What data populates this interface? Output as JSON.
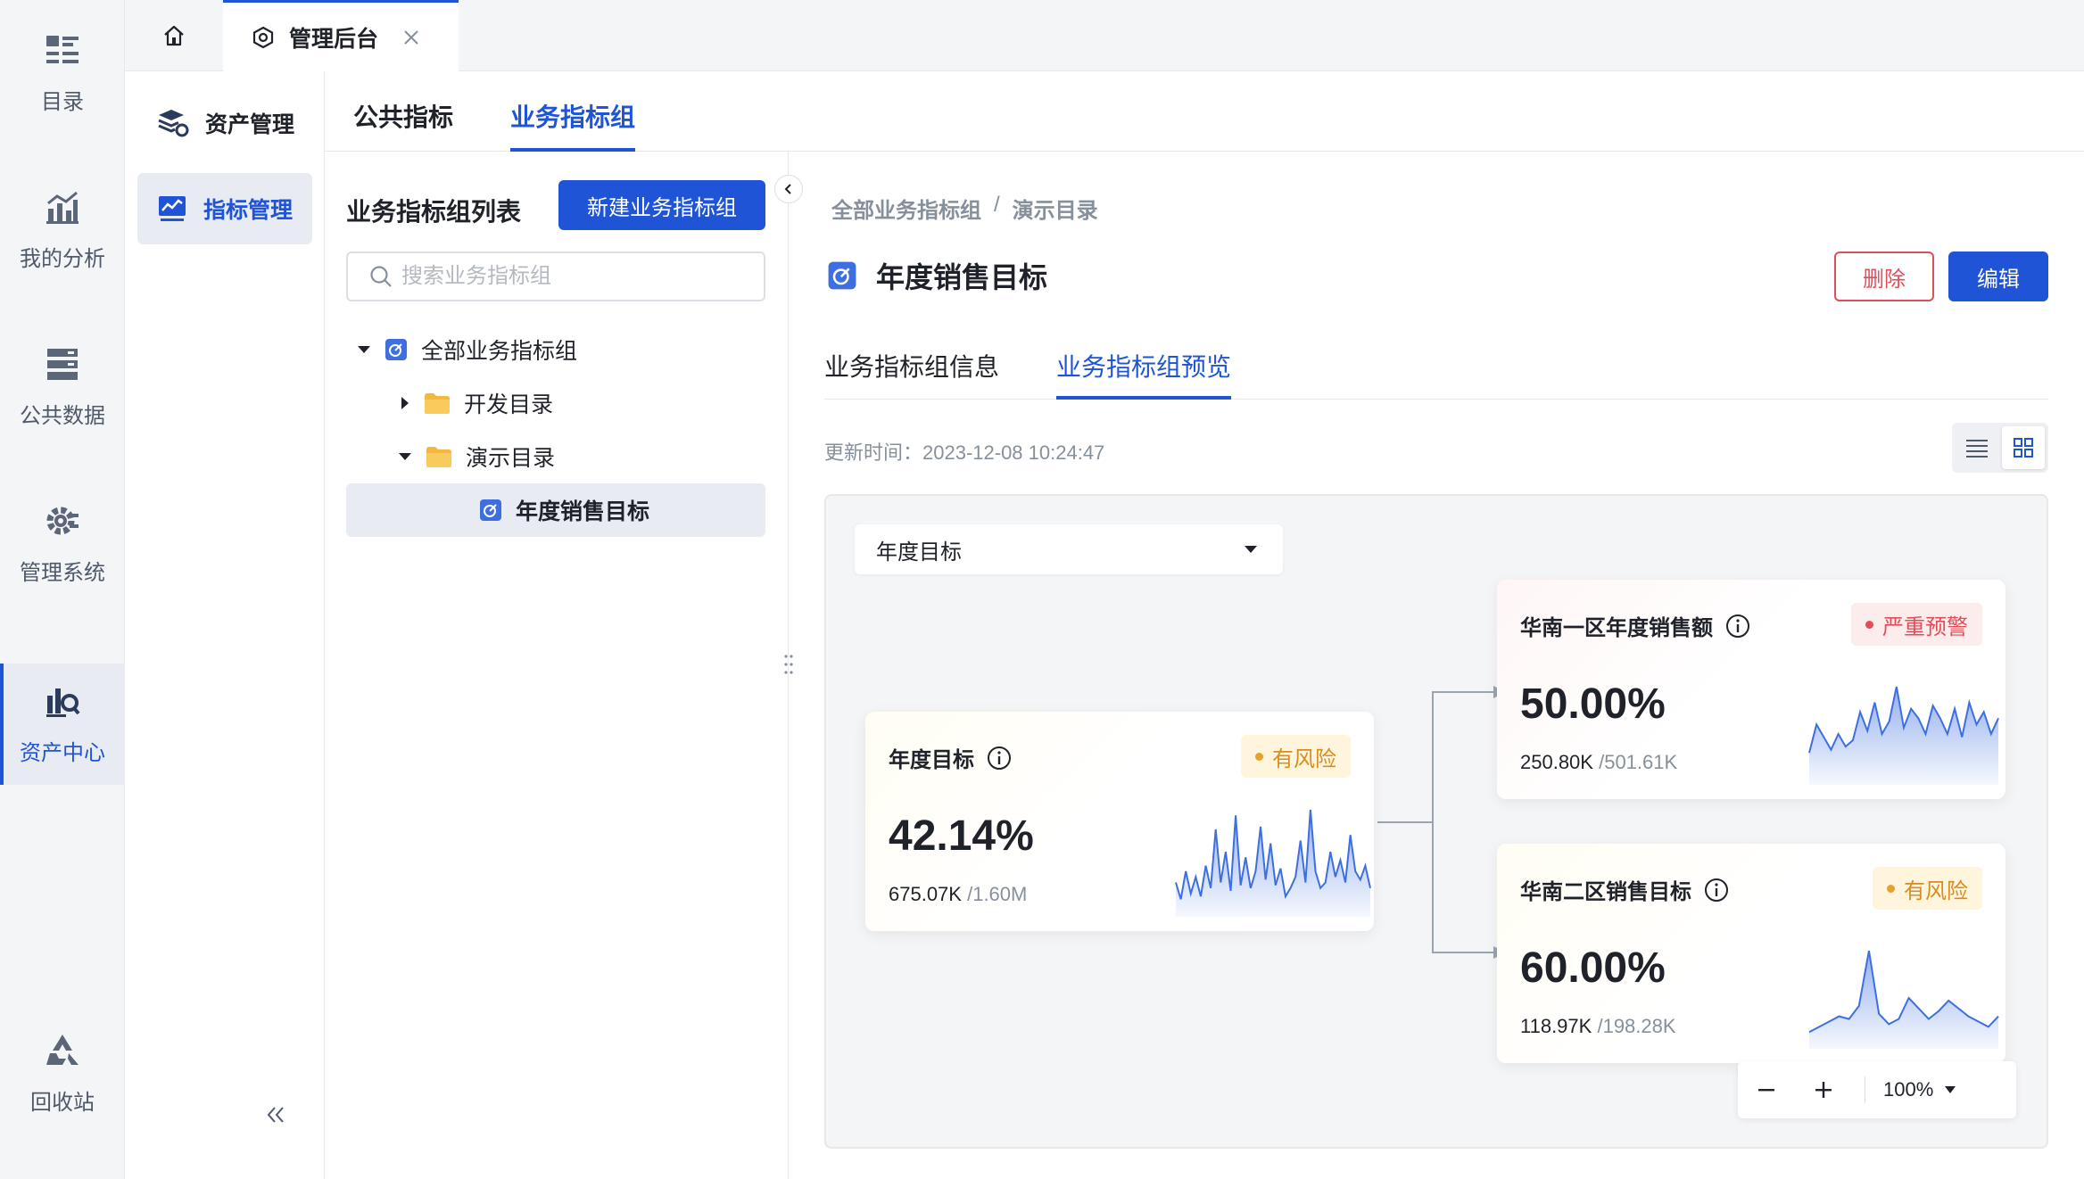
{
  "rail": {
    "items": [
      {
        "label": "目录"
      },
      {
        "label": "我的分析"
      },
      {
        "label": "公共数据"
      },
      {
        "label": "管理系统"
      },
      {
        "label": "资产中心"
      },
      {
        "label": "回收站"
      }
    ],
    "active_index": 4
  },
  "topbar": {
    "tab_label": "管理后台"
  },
  "side2": {
    "items": [
      {
        "label": "资产管理"
      },
      {
        "label": "指标管理"
      }
    ]
  },
  "main_tabs": [
    {
      "label": "公共指标"
    },
    {
      "label": "业务指标组"
    }
  ],
  "tree_panel": {
    "title": "业务指标组列表",
    "new_button": "新建业务指标组",
    "search_placeholder": "搜索业务指标组",
    "nodes": [
      {
        "label": "全部业务指标组"
      },
      {
        "label": "开发目录"
      },
      {
        "label": "演示目录"
      },
      {
        "label": "年度销售目标"
      }
    ]
  },
  "detail": {
    "breadcrumb": [
      "全部业务指标组",
      "/",
      "演示目录"
    ],
    "title": "年度销售目标",
    "delete_button": "删除",
    "edit_button": "编辑",
    "tabs": [
      {
        "label": "业务指标组信息"
      },
      {
        "label": "业务指标组预览"
      }
    ],
    "update_time": "更新时间：2023-12-08 10:24:47"
  },
  "canvas": {
    "select_value": "年度目标",
    "zoom_level": "100%",
    "cards": [
      {
        "name": "年度目标",
        "badge": "有风险",
        "pct": "42.14%",
        "value": "675.07K",
        "target": "/1.60M",
        "trend": [
          22,
          10,
          30,
          14,
          26,
          12,
          34,
          18,
          60,
          22,
          44,
          16,
          70,
          20,
          40,
          18,
          30,
          62,
          24,
          50,
          20,
          32,
          12,
          18,
          26,
          52,
          22,
          74,
          30,
          18,
          22,
          44,
          26,
          38,
          22,
          56,
          30,
          24,
          34,
          18
        ]
      },
      {
        "name": "华南一区年度销售额",
        "badge": "严重预警",
        "pct": "50.00%",
        "value": "250.80K",
        "target": "/501.61K",
        "trend": [
          18,
          36,
          28,
          20,
          30,
          22,
          26,
          44,
          32,
          50,
          30,
          38,
          60,
          34,
          46,
          40,
          30,
          48,
          40,
          30,
          46,
          28,
          50,
          36,
          44,
          30,
          40
        ]
      },
      {
        "name": "华南二区销售目标",
        "badge": "有风险",
        "pct": "60.00%",
        "value": "118.97K",
        "target": "/198.28K",
        "trend": [
          10,
          14,
          18,
          22,
          20,
          30,
          72,
          24,
          16,
          20,
          36,
          28,
          20,
          26,
          34,
          28,
          22,
          18,
          14,
          22
        ]
      }
    ]
  },
  "colors": {
    "primary": "#1f54d6",
    "danger": "#e34d59",
    "warning": "#e5a32b",
    "spark_line": "#3d6fe0"
  }
}
